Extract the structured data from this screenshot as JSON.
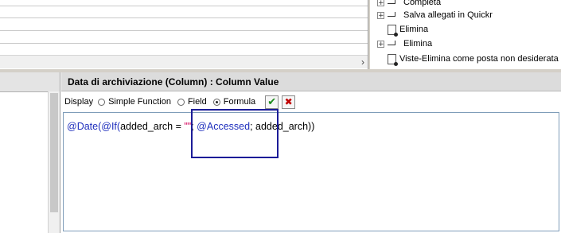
{
  "tree": {
    "items": [
      {
        "label": "Completa",
        "expandable": true,
        "icon": "folder-icon"
      },
      {
        "label": "Salva allegati in Quickr",
        "expandable": true,
        "icon": "folder-icon"
      },
      {
        "label": "Elimina",
        "expandable": false,
        "icon": "view-icon"
      },
      {
        "label": "Elimina",
        "expandable": true,
        "icon": "folder-icon"
      },
      {
        "label": "Viste-Elimina come posta non desiderata",
        "expandable": false,
        "icon": "view-icon"
      }
    ],
    "expander_symbol": "+"
  },
  "scroll": {
    "right_arrow": "›"
  },
  "editor": {
    "title": "Data di archiviazione (Column) : Column Value",
    "display_label": "Display",
    "options": [
      {
        "label": "Simple Function",
        "selected": false
      },
      {
        "label": "Field",
        "selected": false
      },
      {
        "label": "Formula",
        "selected": true
      }
    ],
    "accept_symbol": "✔",
    "cancel_symbol": "✖",
    "formula": {
      "part1": "@Date(@If(",
      "part2": "added_arch = ",
      "part3": "\"\"",
      "part4": "; ",
      "part5": "@Accessed",
      "part6": "; added_arch))"
    }
  },
  "colors": {
    "function": "#1f2fbd",
    "string": "#d4005a",
    "accept": "#1a8a1a",
    "cancel": "#c00000",
    "highlight": "#1c1c98"
  }
}
